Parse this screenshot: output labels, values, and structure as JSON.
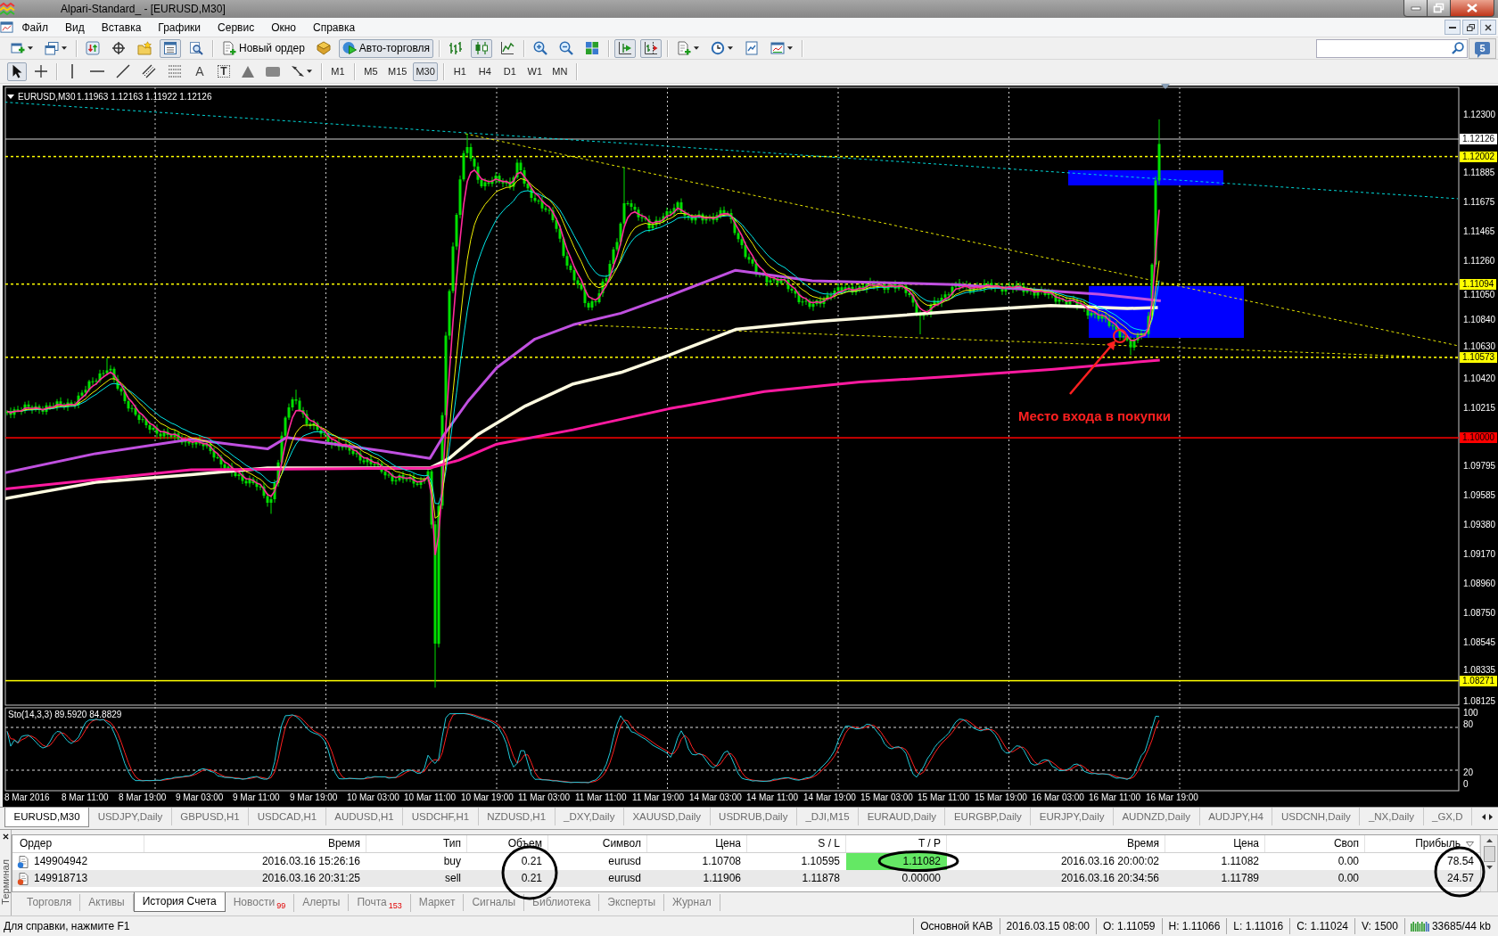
{
  "window": {
    "title": "Alpari-Standard_ - [EURUSD,M30]"
  },
  "menu": [
    "Файл",
    "Вид",
    "Вставка",
    "Графики",
    "Сервис",
    "Окно",
    "Справка"
  ],
  "toolbar": {
    "groups": [
      [
        {
          "kind": "new-chart",
          "pressed": false
        },
        {
          "kind": "profiles",
          "pressed": false
        }
      ],
      [
        {
          "kind": "market-watch",
          "pressed": false
        },
        {
          "kind": "navigator",
          "pressed": false
        },
        {
          "kind": "favorites",
          "pressed": false
        },
        {
          "kind": "terminal",
          "pressed": true
        },
        {
          "kind": "tester",
          "pressed": false
        }
      ],
      [
        {
          "kind": "new-order",
          "label": "Новый ордер",
          "pressed": false
        },
        {
          "kind": "editor",
          "pressed": false
        },
        {
          "kind": "autotrading",
          "label": "Авто-торговля",
          "pressed": true
        }
      ],
      [
        {
          "kind": "bar-chart",
          "pressed": false
        },
        {
          "kind": "candle-chart",
          "pressed": true
        },
        {
          "kind": "line-chart",
          "pressed": false
        }
      ],
      [
        {
          "kind": "zoom-in",
          "pressed": false
        },
        {
          "kind": "zoom-out",
          "pressed": false
        },
        {
          "kind": "tile",
          "pressed": false
        }
      ],
      [
        {
          "kind": "auto-scroll",
          "pressed": true
        },
        {
          "kind": "chart-shift",
          "pressed": true
        }
      ],
      [
        {
          "kind": "indicators",
          "pressed": false
        },
        {
          "kind": "periods",
          "pressed": false
        },
        {
          "kind": "templates",
          "pressed": false
        },
        {
          "kind": "properties",
          "pressed": false
        }
      ]
    ],
    "messages": "5"
  },
  "drawing_toolbar": {
    "groups": [
      [
        {
          "kind": "cursor",
          "pressed": true
        },
        {
          "kind": "crosshair",
          "pressed": false
        }
      ],
      [
        {
          "kind": "vertical-line",
          "pressed": false
        },
        {
          "kind": "horizontal-line",
          "pressed": false
        },
        {
          "kind": "trend-line",
          "pressed": false
        },
        {
          "kind": "channel",
          "pressed": false
        },
        {
          "kind": "fibonacci",
          "pressed": false
        },
        {
          "kind": "text",
          "label": "A",
          "pressed": false
        },
        {
          "kind": "text-label",
          "label": "T",
          "pressed": false
        },
        {
          "kind": "triangle",
          "pressed": false
        },
        {
          "kind": "rectangle",
          "pressed": false
        },
        {
          "kind": "arrows",
          "pressed": false
        }
      ],
      [
        {
          "kind": "timeframe",
          "label": "M1",
          "selected": false
        }
      ],
      [
        {
          "kind": "timeframe",
          "label": "M5",
          "selected": false
        },
        {
          "kind": "timeframe",
          "label": "M15",
          "selected": false
        },
        {
          "kind": "timeframe",
          "label": "M30",
          "selected": true
        }
      ],
      [
        {
          "kind": "timeframe",
          "label": "H1",
          "selected": false
        },
        {
          "kind": "timeframe",
          "label": "H4",
          "selected": false
        },
        {
          "kind": "timeframe",
          "label": "D1",
          "selected": false
        },
        {
          "kind": "timeframe",
          "label": "W1",
          "selected": false
        },
        {
          "kind": "timeframe",
          "label": "MN",
          "selected": false
        }
      ]
    ]
  },
  "chart": {
    "symbol": "EURUSD,M30",
    "prices": "1.11963 1.12163 1.11922 1.12126",
    "price_ticks": [
      "1.12300",
      "1.11885",
      "1.11675",
      "1.11465",
      "1.11260",
      "1.11050",
      "1.10840",
      "1.10630",
      "1.10420",
      "1.10215",
      "1.09795",
      "1.09585",
      "1.09380",
      "1.09170",
      "1.08960",
      "1.08750",
      "1.08545",
      "1.08335",
      "1.08125"
    ],
    "price_markers": [
      {
        "label": "1.12126",
        "kind": "bid",
        "color": "#ffffff",
        "dashed": false
      },
      {
        "label": "1.12002",
        "kind": "level",
        "color": "#ffff00",
        "dashed": true
      },
      {
        "label": "1.11094",
        "kind": "level",
        "color": "#ffff00",
        "dashed": true
      },
      {
        "label": "1.10573",
        "kind": "level",
        "color": "#ffff00",
        "dashed": true
      },
      {
        "label": "1.10000",
        "kind": "level",
        "color": "#ff0000",
        "dashed": false
      },
      {
        "label": "1.08271",
        "kind": "level",
        "color": "#ffff00",
        "dashed": false
      }
    ],
    "annotation": "Место входа в покупки",
    "indicator": {
      "label": "Sto(14,3,3) 89.5920 84.8829",
      "ticks": [
        "100",
        "80",
        "20",
        "0"
      ]
    },
    "time_ticks": [
      "8 Mar 2016",
      "8 Mar 11:00",
      "8 Mar 19:00",
      "9 Mar 03:00",
      "9 Mar 11:00",
      "9 Mar 19:00",
      "10 Mar 03:00",
      "10 Mar 11:00",
      "10 Mar 19:00",
      "11 Mar 03:00",
      "11 Mar 11:00",
      "11 Mar 19:00",
      "14 Mar 03:00",
      "14 Mar 11:00",
      "14 Mar 19:00",
      "15 Mar 03:00",
      "15 Mar 11:00",
      "15 Mar 19:00",
      "16 Mar 03:00",
      "16 Mar 11:00",
      "16 Mar 19:00"
    ]
  },
  "symbol_tabs": [
    {
      "label": "EURUSD,M30",
      "selected": true
    },
    {
      "label": "USDJPY,Daily",
      "selected": false
    },
    {
      "label": "GBPUSD,H1",
      "selected": false
    },
    {
      "label": "USDCAD,H1",
      "selected": false
    },
    {
      "label": "AUDUSD,H1",
      "selected": false
    },
    {
      "label": "USDCHF,H1",
      "selected": false
    },
    {
      "label": "NZDUSD,H1",
      "selected": false
    },
    {
      "label": "_DXY,Daily",
      "selected": false
    },
    {
      "label": "XAUUSD,Daily",
      "selected": false
    },
    {
      "label": "USDRUB,Daily",
      "selected": false
    },
    {
      "label": "_DJI,M15",
      "selected": false
    },
    {
      "label": "EURAUD,Daily",
      "selected": false
    },
    {
      "label": "EURGBP,Daily",
      "selected": false
    },
    {
      "label": "EURJPY,Daily",
      "selected": false
    },
    {
      "label": "AUDNZD,Daily",
      "selected": false
    },
    {
      "label": "AUDJPY,H4",
      "selected": false
    },
    {
      "label": "USDCNH,Daily",
      "selected": false
    },
    {
      "label": "_NX,Daily",
      "selected": false
    },
    {
      "label": "_GX,D",
      "selected": false
    }
  ],
  "terminal": {
    "title": "Терминал",
    "columns": [
      {
        "label": "Ордер",
        "sorted": false
      },
      {
        "label": "Время",
        "sorted": false
      },
      {
        "label": "Тип",
        "sorted": false
      },
      {
        "label": "Объем",
        "sorted": false
      },
      {
        "label": "Символ",
        "sorted": false
      },
      {
        "label": "Цена",
        "sorted": false
      },
      {
        "label": "S / L",
        "sorted": false
      },
      {
        "label": "T / P",
        "sorted": false
      },
      {
        "label": "Время",
        "sorted": false
      },
      {
        "label": "Цена",
        "sorted": false
      },
      {
        "label": "Своп",
        "sorted": false
      },
      {
        "label": "Прибыль",
        "sorted": true
      }
    ],
    "rows": [
      {
        "kind": "buy",
        "tp_hit": true,
        "cells": [
          "149904942",
          "2016.03.16 15:26:16",
          "buy",
          "0.21",
          "eurusd",
          "1.10708",
          "1.10595",
          "1.11082",
          "2016.03.16 20:00:02",
          "1.11082",
          "0.00",
          "78.54"
        ]
      },
      {
        "kind": "sell",
        "tp_hit": false,
        "cells": [
          "149918713",
          "2016.03.16 20:31:25",
          "sell",
          "0.21",
          "eurusd",
          "1.11906",
          "1.11878",
          "0.00000",
          "2016.03.16 20:34:56",
          "1.11789",
          "0.00",
          "24.57"
        ]
      }
    ],
    "tabs": [
      {
        "label": "Торговля",
        "selected": false
      },
      {
        "label": "Активы",
        "selected": false
      },
      {
        "label": "История Счета",
        "selected": true
      },
      {
        "label": "Новости",
        "badge": "99",
        "selected": false
      },
      {
        "label": "Алерты",
        "selected": false
      },
      {
        "label": "Почта",
        "badge": "153",
        "selected": false
      },
      {
        "label": "Маркет",
        "selected": false
      },
      {
        "label": "Сигналы",
        "selected": false
      },
      {
        "label": "Библиотека",
        "selected": false
      },
      {
        "label": "Эксперты",
        "selected": false
      },
      {
        "label": "Журнал",
        "selected": false
      }
    ]
  },
  "status_bar": {
    "help": "Для справки, нажмите F1",
    "profile": "Основной КАВ",
    "time": "2016.03.15 08:00",
    "open": "O: 1.11059",
    "high": "H: 1.11066",
    "low": "L: 1.11016",
    "close": "C: 1.11024",
    "volume": "V: 1500",
    "traffic": "33685/44 kb"
  }
}
